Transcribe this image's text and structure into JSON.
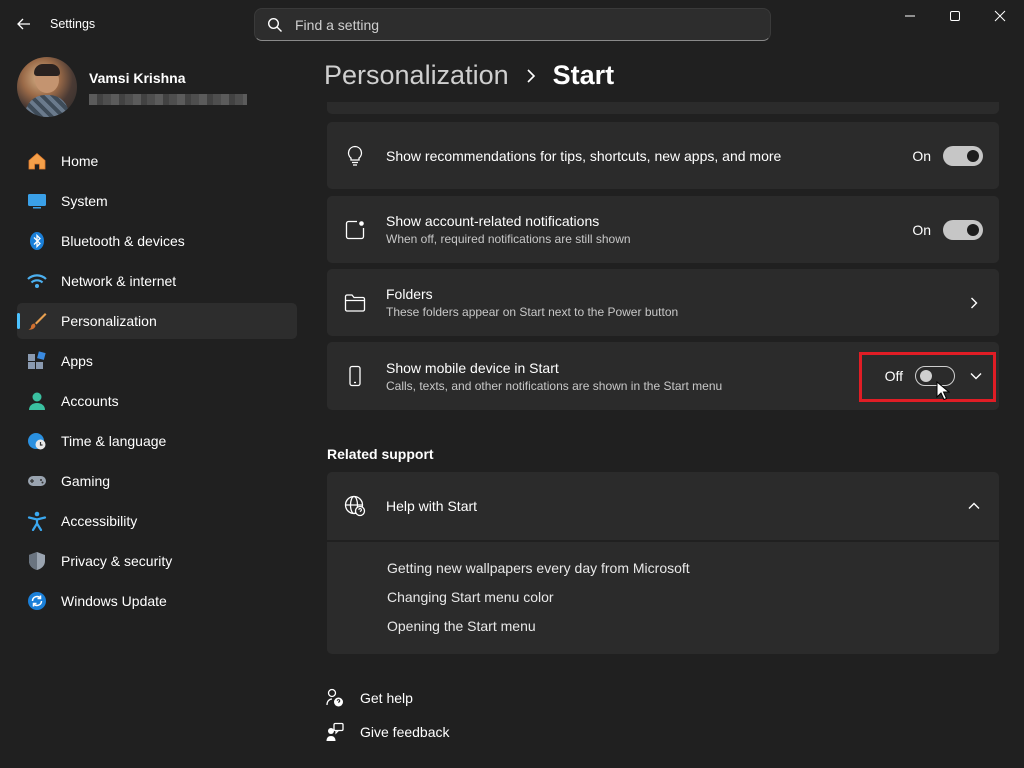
{
  "window": {
    "title": "Settings",
    "controls": {
      "minimize": "minimize-icon",
      "maximize": "maximize-icon",
      "close": "close-icon"
    }
  },
  "search": {
    "placeholder": "Find a setting",
    "value": ""
  },
  "profile": {
    "name": "Vamsi Krishna"
  },
  "sidebar": {
    "items": [
      {
        "label": "Home",
        "icon": "home-icon"
      },
      {
        "label": "System",
        "icon": "monitor-icon"
      },
      {
        "label": "Bluetooth & devices",
        "icon": "bluetooth-icon"
      },
      {
        "label": "Network & internet",
        "icon": "wifi-icon"
      },
      {
        "label": "Personalization",
        "icon": "brush-icon",
        "active": true
      },
      {
        "label": "Apps",
        "icon": "apps-icon"
      },
      {
        "label": "Accounts",
        "icon": "person-icon"
      },
      {
        "label": "Time & language",
        "icon": "globe-clock-icon"
      },
      {
        "label": "Gaming",
        "icon": "gamepad-icon"
      },
      {
        "label": "Accessibility",
        "icon": "accessibility-icon"
      },
      {
        "label": "Privacy & security",
        "icon": "shield-icon"
      },
      {
        "label": "Windows Update",
        "icon": "update-icon"
      }
    ]
  },
  "breadcrumb": {
    "parent": "Personalization",
    "current": "Start"
  },
  "settings": [
    {
      "title": "Show recommendations for tips, shortcuts, new apps, and more",
      "desc": "",
      "state": "On",
      "icon": "lightbulb-icon"
    },
    {
      "title": "Show account-related notifications",
      "desc": "When off, required notifications are still shown",
      "state": "On",
      "icon": "notification-icon"
    },
    {
      "title": "Folders",
      "desc": "These folders appear on Start next to the Power button",
      "icon": "folder-icon"
    },
    {
      "title": "Show mobile device in Start",
      "desc": "Calls, texts, and other notifications are shown in the Start menu",
      "state": "Off",
      "icon": "phone-icon"
    }
  ],
  "related": {
    "title": "Related support",
    "help_title": "Help with Start",
    "links": [
      "Getting new wallpapers every day from Microsoft",
      "Changing Start menu color",
      "Opening the Start menu"
    ]
  },
  "footer": {
    "get_help": "Get help",
    "give_feedback": "Give feedback"
  },
  "colors": {
    "accent": "#4cc2ff",
    "highlight": "#e01d25",
    "background": "#202020",
    "card": "#2b2b2b"
  }
}
